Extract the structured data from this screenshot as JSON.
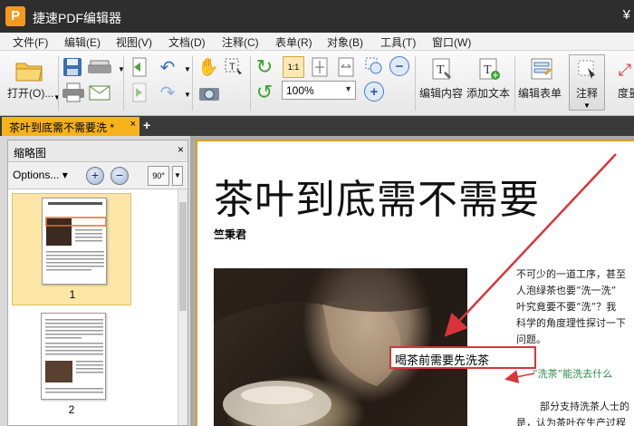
{
  "window": {
    "title": "捷速PDF编辑器",
    "logo_letter": "P",
    "top_right_glyph": "¥"
  },
  "menu": [
    "文件(F)",
    "编辑(E)",
    "视图(V)",
    "文档(D)",
    "注释(C)",
    "表单(R)",
    "对象(B)",
    "工具(T)",
    "窗口(W)"
  ],
  "toolbar": {
    "open_label": "打开(O)...",
    "zoom_value": "100%",
    "edit_content_label": "编辑内容",
    "add_text_label": "添加文本",
    "edit_form_label": "编辑表单",
    "annotate_label": "注释",
    "measure_label": "度量",
    "actual_size_label": "1:1",
    "rotate_label": "90°"
  },
  "tabs": {
    "active": "茶叶到底需不需要洗 *",
    "close": "×",
    "new": "+"
  },
  "side_panel": {
    "title": "缩略图",
    "options_label": "Options...",
    "close": "×",
    "thumbnails": [
      {
        "page": "1",
        "selected": true
      },
      {
        "page": "2",
        "selected": false
      }
    ]
  },
  "document": {
    "title": "茶叶到底需不需要",
    "author": "竺秉君",
    "callout": "喝茶前需要先洗茶",
    "body_lines": [
      "不可少的一道工序，甚至",
      "人泡绿茶也要“洗一洗”",
      "叶究竟要不要“洗”？我",
      "科学的角度理性探讨一下",
      "问题。"
    ],
    "green_line": "“洗茶”能洗去什么",
    "body_lines_2": [
      "部分支持洗茶人士的",
      "是，认为茶叶在生产过程"
    ]
  },
  "colors": {
    "accent_tab": "#f7b21c",
    "callout_red": "#d9343a",
    "green_text": "#2d8c4a"
  }
}
